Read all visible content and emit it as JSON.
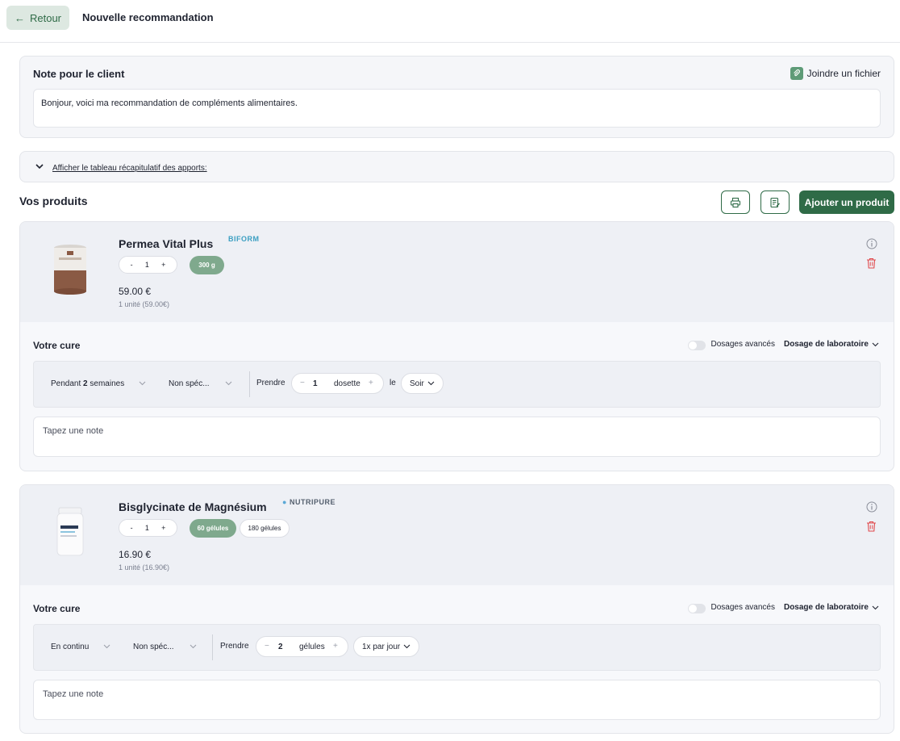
{
  "header": {
    "back_label": "Retour",
    "title": "Nouvelle recommandation"
  },
  "note_section": {
    "title": "Note pour le client",
    "attach_label": "Joindre un fichier",
    "text": "Bonjour, voici ma recommandation de compléments alimentaires."
  },
  "summary": {
    "link": "Afficher le tableau récapitulatif des apports:"
  },
  "products_section": {
    "title": "Vos produits",
    "add_label": "Ajouter un produit"
  },
  "products": [
    {
      "name": "Permea Vital Plus",
      "brand": "BIFORM",
      "qty_minus": "-",
      "qty": "1",
      "qty_plus": "+",
      "formats": [
        "300 g"
      ],
      "price": "59.00 €",
      "unit_price": "1 unité (59.00€)",
      "cure": {
        "title": "Votre cure",
        "advanced_label": "Dosages avancés",
        "lab_label": "Dosage de laboratoire",
        "duration_prefix": "Pendant",
        "duration_value": "2",
        "duration_suffix": "semaines",
        "moment": "Non spéc...",
        "take_label": "Prendre",
        "dose_minus": "−",
        "dose": "1",
        "dose_unit": "dosette",
        "dose_plus": "+",
        "connector": "le",
        "timing": "Soir",
        "note_placeholder": "Tapez une note"
      }
    },
    {
      "name": "Bisglycinate de Magnésium",
      "brand": "NUTRIPURE",
      "qty_minus": "-",
      "qty": "1",
      "qty_plus": "+",
      "formats": [
        "60 gélules",
        "180 gélules"
      ],
      "price": "16.90 €",
      "unit_price": "1 unité (16.90€)",
      "cure": {
        "title": "Votre cure",
        "advanced_label": "Dosages avancés",
        "lab_label": "Dosage de laboratoire",
        "duration": "En continu",
        "moment": "Non spéc...",
        "take_label": "Prendre",
        "dose_minus": "−",
        "dose": "2",
        "dose_unit": "gélules",
        "dose_plus": "+",
        "frequency": "1x par jour",
        "note_placeholder": "Tapez une note"
      }
    }
  ],
  "colors": {
    "primary": "#2f6b47",
    "chip_selected": "#7fa98d",
    "danger": "#e0484b"
  }
}
